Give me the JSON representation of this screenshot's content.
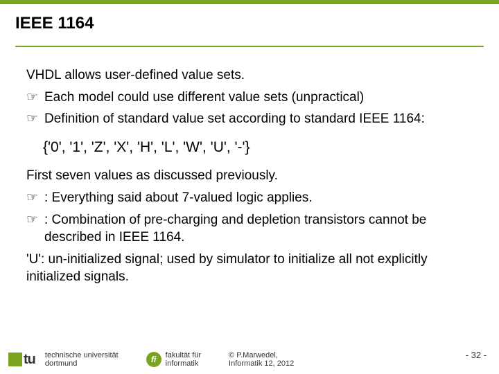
{
  "title": "IEEE 1164",
  "body": {
    "intro": "VHDL allows user-defined value sets.",
    "bullets1": [
      "Each model could use different value sets (unpractical)",
      "Definition of standard value set according to standard IEEE 1164:"
    ],
    "valueset": "{'0', '1', 'Z', 'X', 'H', 'L', 'W', 'U', '-'}",
    "p2": "First seven values as discussed previously.",
    "bullets2": [
      ": Everything said about 7-valued logic applies.",
      ": Combination of pre-charging and depletion transistors cannot be described in IEEE 1164."
    ],
    "p3": "'U': un-initialized signal; used by simulator to initialize all not explicitly initialized signals."
  },
  "footer": {
    "tu": "tu",
    "uni_line1": "technische universität",
    "uni_line2": "dortmund",
    "fi": "fi",
    "fak_line1": "fakultät für",
    "fak_line2": "informatik",
    "copy_line1": "© P.Marwedel,",
    "copy_line2": "Informatik 12,  2012",
    "page": "-  32 -"
  },
  "glyph": {
    "hand": "☞"
  }
}
